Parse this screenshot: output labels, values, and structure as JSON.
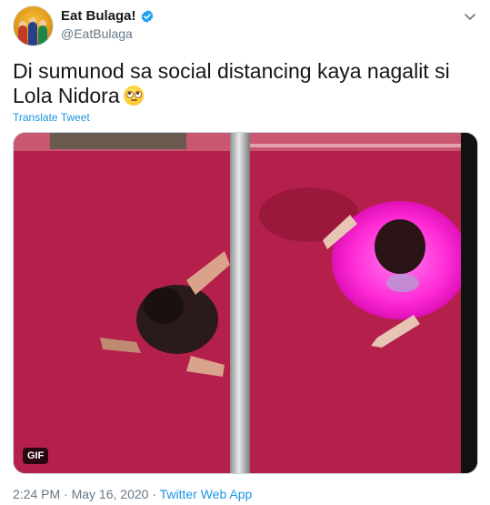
{
  "tweet": {
    "display_name": "Eat Bulaga!",
    "handle": "@EatBulaga",
    "text": "Di sumunod sa social distancing kaya nagalit si Lola Nidora",
    "translate_label": "Translate Tweet",
    "media_badge": "GIF",
    "time": "2:24 PM",
    "date": "May 16, 2020",
    "separator": "·",
    "source": "Twitter Web App"
  },
  "icons": {
    "verified": "verified-badge-icon",
    "menu": "chevron-down-icon",
    "emoji": "face-with-rolling-eyes-emoji"
  },
  "colors": {
    "link": "#1b95e0",
    "secondary_text": "#657786",
    "verified": "#1da1f2",
    "floor": "#b4204b",
    "tutu": "#ff2bd6"
  }
}
